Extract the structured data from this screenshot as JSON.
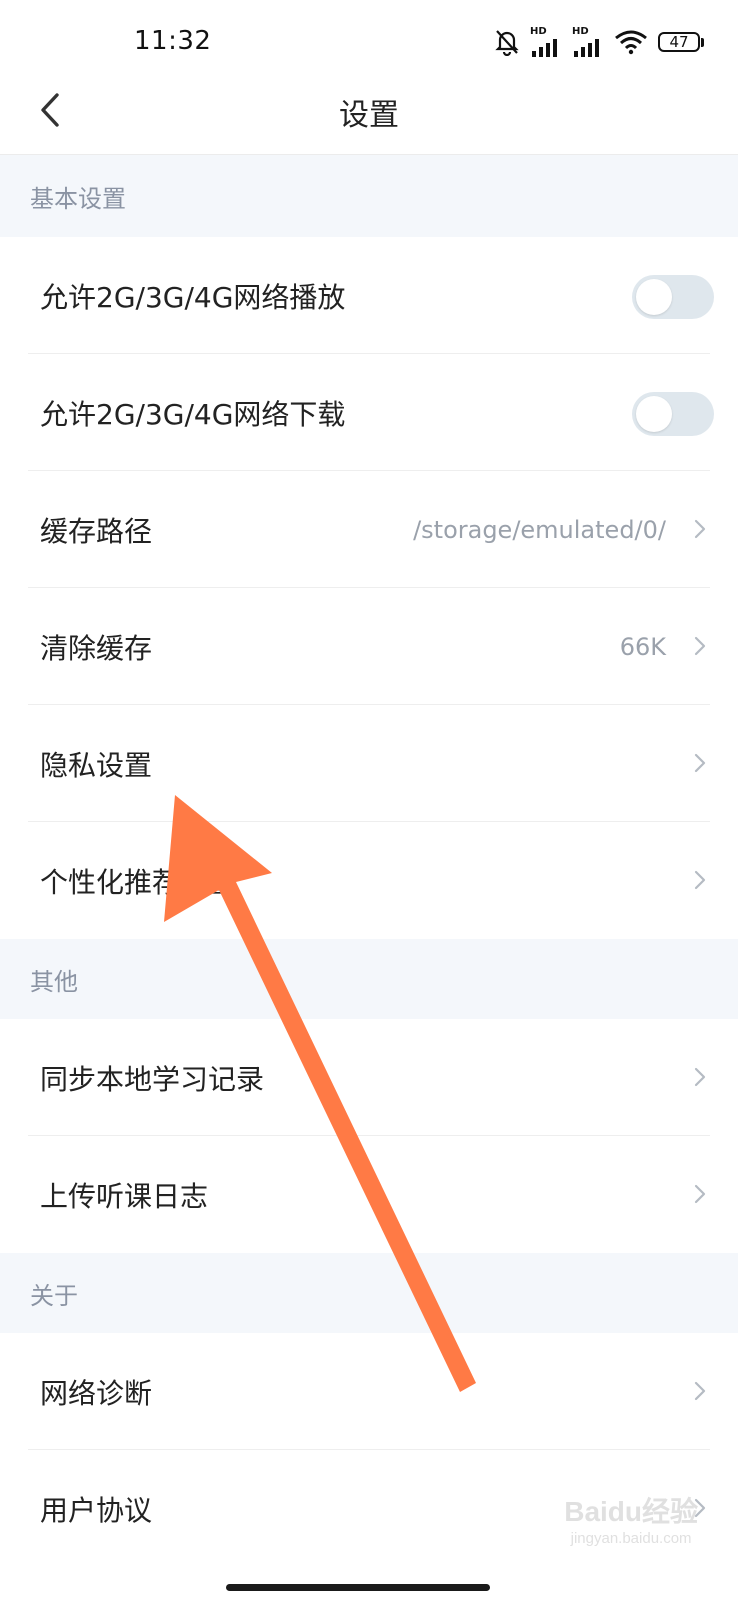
{
  "status_bar": {
    "time": "11:32",
    "hd_label": "HD",
    "battery": "47"
  },
  "nav": {
    "title": "设置"
  },
  "sections": [
    {
      "title": "基本设置"
    },
    {
      "title": "其他"
    },
    {
      "title": "关于"
    }
  ],
  "rows": [
    {
      "label": "允许2G/3G/4G网络播放",
      "toggle_on": false
    },
    {
      "label": "允许2G/3G/4G网络下载",
      "toggle_on": false
    },
    {
      "label": "缓存路径",
      "value": "/storage/emulated/0/"
    },
    {
      "label": "清除缓存",
      "value": "66K"
    },
    {
      "label": "隐私设置"
    },
    {
      "label": "个性化推荐设置"
    },
    {
      "label": "同步本地学习记录"
    },
    {
      "label": "上传听课日志"
    },
    {
      "label": "网络诊断"
    },
    {
      "label": "用户协议"
    }
  ],
  "annotation": {
    "arrow_color": "#ff7a45"
  },
  "watermark": {
    "logo": "Baidu经验",
    "url": "jingyan.baidu.com"
  }
}
